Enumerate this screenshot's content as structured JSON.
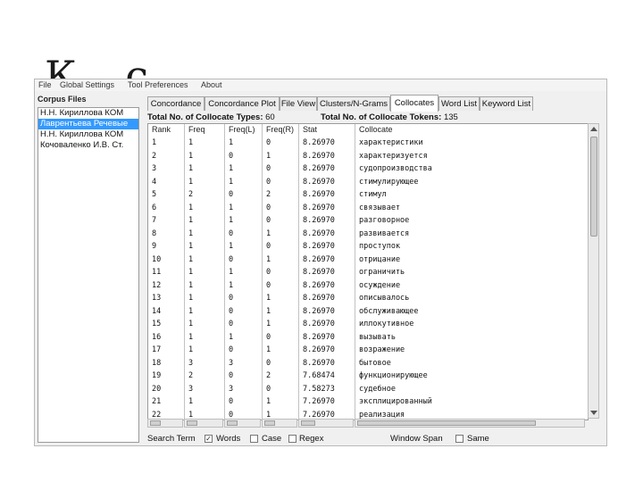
{
  "slide": {
    "title_fragment": "К  с"
  },
  "menu": [
    "File",
    "Global Settings",
    "Tool Preferences",
    "About"
  ],
  "left_panel": {
    "title": "Corpus Files",
    "files": [
      {
        "label": "Н.Н. Кириллова КОМ",
        "selected": false
      },
      {
        "label": "Лаврентьева Речевые",
        "selected": true
      },
      {
        "label": "Н.Н. Кириллова КОМ",
        "selected": false
      },
      {
        "label": "Кочоваленко И.В. Ст.",
        "selected": false
      }
    ]
  },
  "tabs": [
    "Concordance",
    "Concordance Plot",
    "File View",
    "Clusters/N-Grams",
    "Collocates",
    "Word List",
    "Keyword List"
  ],
  "active_tab": "Collocates",
  "stats": {
    "types_label": "Total No. of Collocate Types:",
    "types_value": "60",
    "tokens_label": "Total No. of Collocate Tokens:",
    "tokens_value": "135"
  },
  "table": {
    "headers": [
      "Rank",
      "Freq",
      "Freq(L)",
      "Freq(R)",
      "Stat",
      "Collocate"
    ],
    "rows": [
      [
        "1",
        "1",
        "1",
        "0",
        "8.26970",
        "характеристики"
      ],
      [
        "2",
        "1",
        "0",
        "1",
        "8.26970",
        "характеризуется"
      ],
      [
        "3",
        "1",
        "1",
        "0",
        "8.26970",
        "судопроизводства"
      ],
      [
        "4",
        "1",
        "1",
        "0",
        "8.26970",
        "стимулирующее"
      ],
      [
        "5",
        "2",
        "0",
        "2",
        "8.26970",
        "стимул"
      ],
      [
        "6",
        "1",
        "1",
        "0",
        "8.26970",
        "связывает"
      ],
      [
        "7",
        "1",
        "1",
        "0",
        "8.26970",
        "разговорное"
      ],
      [
        "8",
        "1",
        "0",
        "1",
        "8.26970",
        "развивается"
      ],
      [
        "9",
        "1",
        "1",
        "0",
        "8.26970",
        "проступок"
      ],
      [
        "10",
        "1",
        "0",
        "1",
        "8.26970",
        "отрицание"
      ],
      [
        "11",
        "1",
        "1",
        "0",
        "8.26970",
        "ограничить"
      ],
      [
        "12",
        "1",
        "1",
        "0",
        "8.26970",
        "осуждение"
      ],
      [
        "13",
        "1",
        "0",
        "1",
        "8.26970",
        "описывалось"
      ],
      [
        "14",
        "1",
        "0",
        "1",
        "8.26970",
        "обслуживающее"
      ],
      [
        "15",
        "1",
        "0",
        "1",
        "8.26970",
        "иллокутивное"
      ],
      [
        "16",
        "1",
        "1",
        "0",
        "8.26970",
        "вызывать"
      ],
      [
        "17",
        "1",
        "0",
        "1",
        "8.26970",
        "возражение"
      ],
      [
        "18",
        "3",
        "3",
        "0",
        "8.26970",
        "бытовое"
      ],
      [
        "19",
        "2",
        "0",
        "2",
        "7.68474",
        "функционирующее"
      ],
      [
        "20",
        "3",
        "3",
        "0",
        "7.58273",
        "судебное"
      ],
      [
        "21",
        "1",
        "0",
        "1",
        "7.26970",
        "эксплицированный"
      ],
      [
        "22",
        "1",
        "0",
        "1",
        "7.26970",
        "реализация"
      ]
    ]
  },
  "search": {
    "label": "Search Term",
    "words_label": "Words",
    "words_checked": true,
    "case_label": "Case",
    "case_checked": false,
    "regex_label": "Regex",
    "regex_checked": false,
    "window_label": "Window Span",
    "same_label": "Same",
    "same_checked": false
  }
}
